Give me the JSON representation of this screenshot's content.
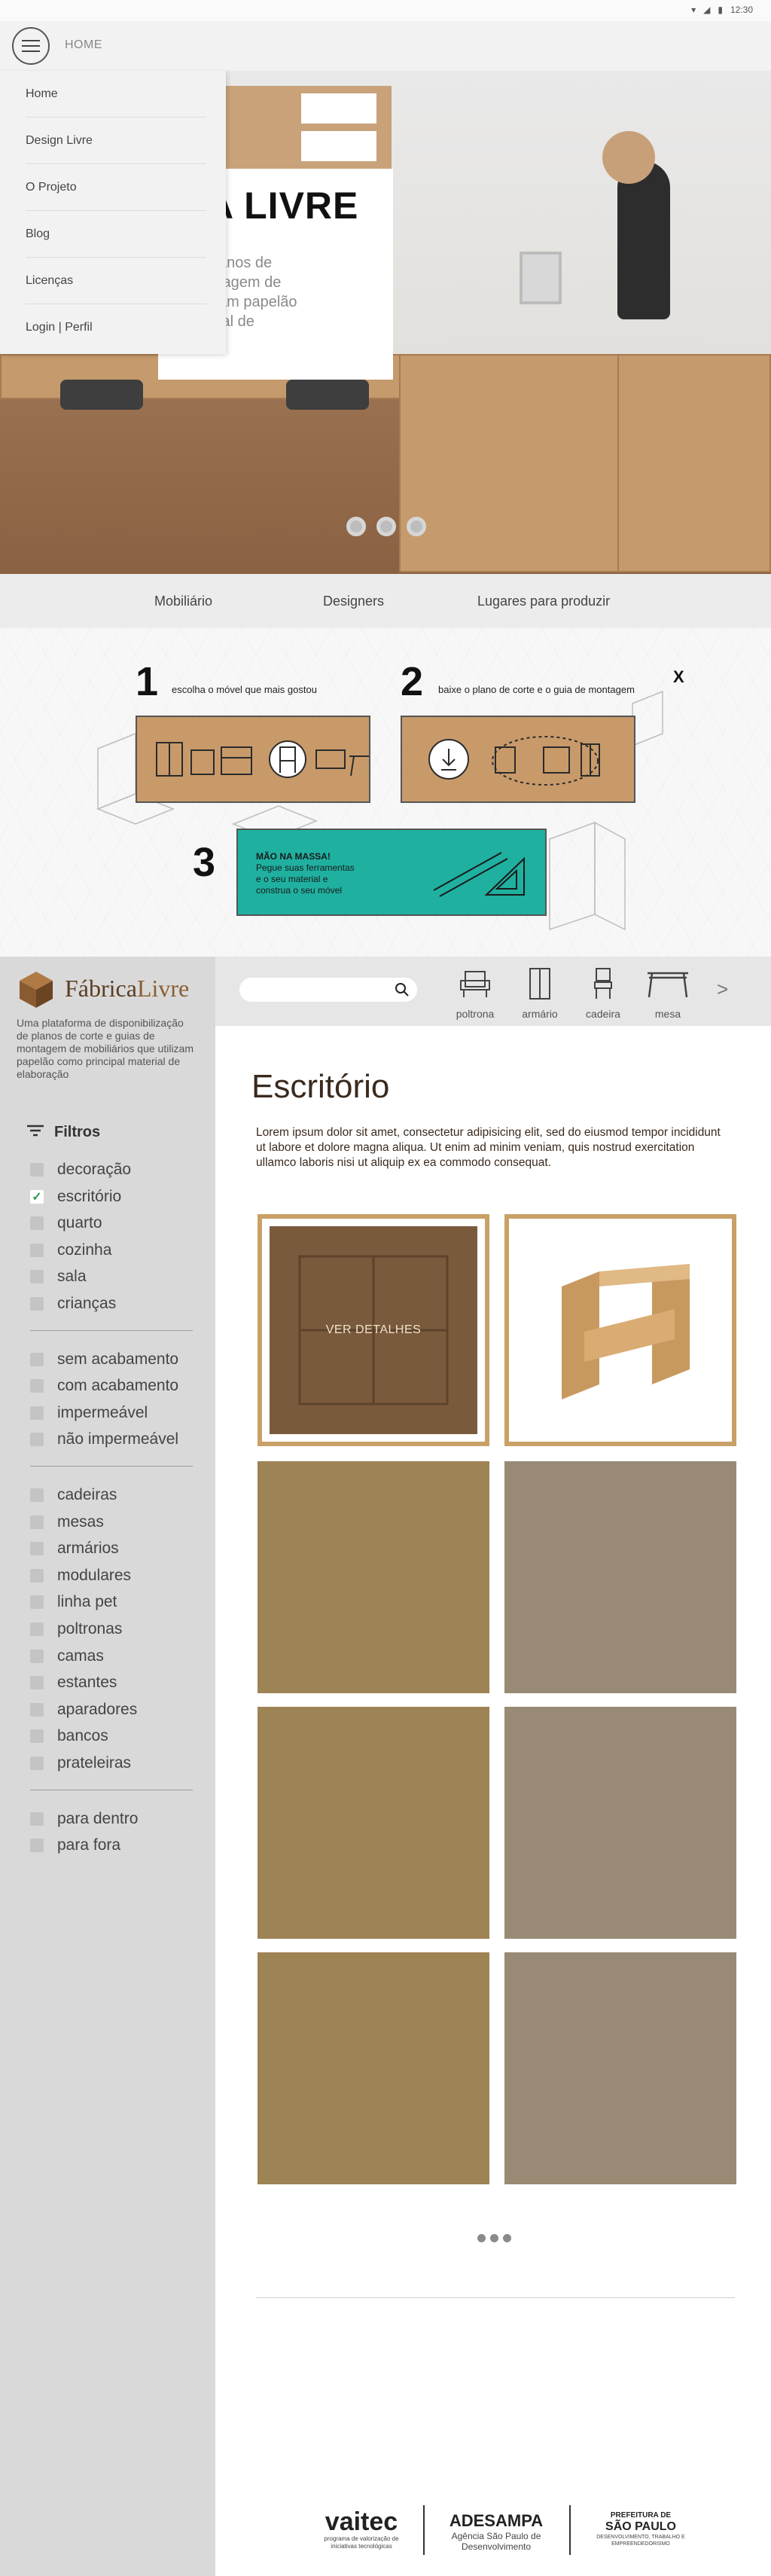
{
  "status_bar": {
    "time": "12:30"
  },
  "appbar": {
    "title": "HOME"
  },
  "drawer": {
    "items": [
      {
        "label": "Home"
      },
      {
        "label": "Design Livre"
      },
      {
        "label": "O Projeto"
      },
      {
        "label": "Blog"
      },
      {
        "label": "Licenças"
      },
      {
        "label": "Login | Perfil"
      }
    ]
  },
  "hero": {
    "title_visible": "A LIVRE",
    "text_visible": "anos de\ntagem de\nam papelão\nial de",
    "dots": 3
  },
  "categories": {
    "tabs": [
      {
        "label": "Mobiliário"
      },
      {
        "label": "Designers"
      },
      {
        "label": "Lugares para produzir"
      }
    ]
  },
  "tutorial": {
    "close_label": "X",
    "steps": [
      {
        "number": "1",
        "caption": "escolha o móvel que mais gostou"
      },
      {
        "number": "2",
        "caption": "baixe o plano de corte e o guia de montagem"
      },
      {
        "number": "3",
        "caption_title": "MÃO NA MASSA!",
        "caption_lines": [
          "Pegue suas ferramentas",
          "e o seu material e",
          "construa o seu móvel"
        ]
      }
    ]
  },
  "sidebar": {
    "logo_part1": "Fábrica",
    "logo_part2": "Livre",
    "tagline": "Uma plataforma de disponibilização de planos de corte e guias de montagem de mobiliários que utilizam papelão como principal material de elaboração",
    "filters_heading": "Filtros",
    "groups": [
      [
        {
          "label": "decoração",
          "checked": false
        },
        {
          "label": "escritório",
          "checked": true
        },
        {
          "label": "quarto",
          "checked": false
        },
        {
          "label": "cozinha",
          "checked": false
        },
        {
          "label": "sala",
          "checked": false
        },
        {
          "label": "crianças",
          "checked": false
        }
      ],
      [
        {
          "label": "sem acabamento",
          "checked": false
        },
        {
          "label": "com acabamento",
          "checked": false
        },
        {
          "label": "impermeável",
          "checked": false
        },
        {
          "label": "não impermeável",
          "checked": false
        }
      ],
      [
        {
          "label": "cadeiras",
          "checked": false
        },
        {
          "label": "mesas",
          "checked": false
        },
        {
          "label": "armários",
          "checked": false
        },
        {
          "label": "modulares",
          "checked": false
        },
        {
          "label": "linha pet",
          "checked": false
        },
        {
          "label": "poltronas",
          "checked": false
        },
        {
          "label": "camas",
          "checked": false
        },
        {
          "label": "estantes",
          "checked": false
        },
        {
          "label": "aparadores",
          "checked": false
        },
        {
          "label": "bancos",
          "checked": false
        },
        {
          "label": "prateleiras",
          "checked": false
        }
      ],
      [
        {
          "label": "para dentro",
          "checked": false
        },
        {
          "label": "para fora",
          "checked": false
        }
      ]
    ]
  },
  "typebar": {
    "search_placeholder": "",
    "types": [
      {
        "label": "poltrona",
        "icon": "armchair-icon"
      },
      {
        "label": "armário",
        "icon": "wardrobe-icon"
      },
      {
        "label": "cadeira",
        "icon": "chair-icon"
      },
      {
        "label": "mesa",
        "icon": "table-icon"
      }
    ],
    "next_label": ">"
  },
  "main": {
    "title": "Escritório",
    "description": "Lorem ipsum dolor sit amet, consectetur adipisicing elit, sed do eiusmod tempor incididunt ut labore et dolore magna aliqua. Ut enim ad minim veniam, quis nostrud exercitation ullamco laboris nisi ut aliquip ex ea commodo consequat.",
    "tile_overlay_label": "VER DETALHES",
    "tile_colors": [
      "#9e8355",
      "#998a75"
    ]
  },
  "footer": {
    "logo1_name": "vaitec",
    "logo1_sub": "programa de valorização de iniciativas tecnológicas",
    "logo2_name": "ADESAMPA",
    "logo2_sub": "Agência São Paulo de Desenvolvimento",
    "logo3_name_1": "PREFEITURA DE",
    "logo3_name_2": "SÃO PAULO",
    "logo3_sub": "DESENVOLVIMENTO, TRABALHO E EMPREENDEDORISMO"
  }
}
